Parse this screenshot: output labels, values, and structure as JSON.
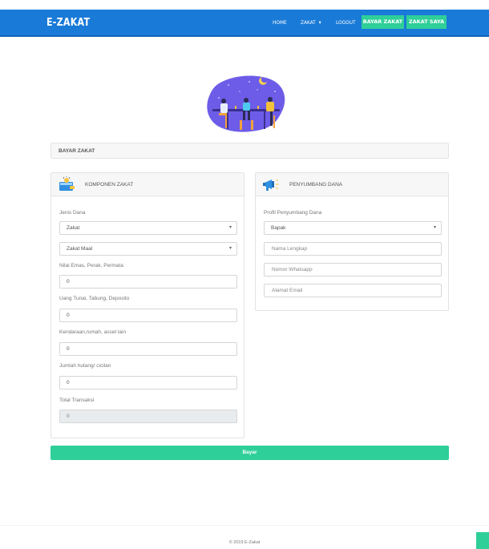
{
  "brand": "E-ZAKAT",
  "nav": {
    "home": "HOME",
    "zakat": "ZAKAT",
    "zakat_caret": "▾",
    "logout": "LOGOUT",
    "bayar_zakat": "BAYAR ZAKAT",
    "zakat_saya": "ZAKAT SAYA"
  },
  "page_title": "BAYAR ZAKAT",
  "komponen": {
    "title": "KOMPONEN ZAKAT",
    "jenis_dana_label": "Jenis Dana",
    "jenis_dana_value": "Zakat",
    "jenis_zakat_value": "Zakat Maal",
    "emas_label": "Nilai Emas, Perak, Permata",
    "emas_value": "0",
    "uang_label": "Uang Tunai, Tabung, Deposito",
    "uang_value": "0",
    "kendaraan_label": "Kendaraan,rumah, asset lain",
    "kendaraan_value": "0",
    "hutang_label": "Jumlah hutang/ cicilan",
    "hutang_value": "0",
    "total_label": "Total Transaksi",
    "total_value": "0"
  },
  "penyumbang": {
    "title": "PENYUMBANG DANA",
    "profil_label": "Profil Penyumbang Dana",
    "profil_value": "Bapak",
    "nama_placeholder": "Nama Lengkap",
    "wa_placeholder": "Nomor Whatsapp",
    "email_placeholder": "Alamat Email"
  },
  "pay_button": "Bayar",
  "footer": "© 2019 E-Zakat",
  "icons": {
    "komponen": "wallet-icon",
    "penyumbang": "megaphone-icon",
    "select_caret": "chevron-down-icon"
  },
  "colors": {
    "primary": "#1a7ad8",
    "accent": "#2ecf99",
    "panel_bg": "#f7f7f7"
  }
}
